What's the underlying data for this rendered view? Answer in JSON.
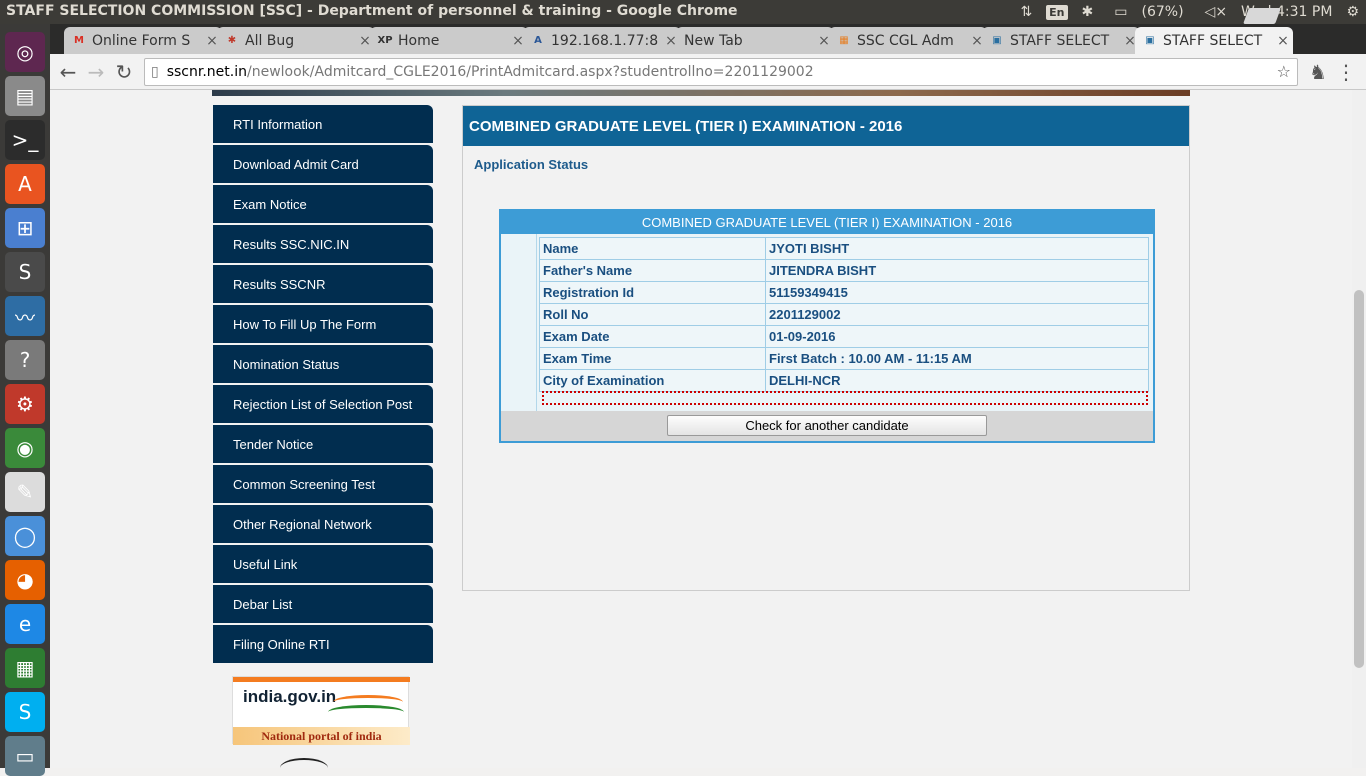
{
  "window_title": "STAFF SELECTION COMMISSION [SSC] - Department of personnel & training - Google Chrome",
  "tray": {
    "keyboard": "En",
    "battery": "(67%)",
    "clock": "Wed  4:31 PM"
  },
  "tabs": [
    {
      "label": "Online Form S",
      "favicon": "gmail-icon",
      "color": "#d93025",
      "glyph": "M"
    },
    {
      "label": "All Bug",
      "favicon": "bug-icon",
      "color": "#c0392b",
      "glyph": "✱"
    },
    {
      "label": "Home",
      "favicon": "xp-icon",
      "color": "#333333",
      "glyph": "XP"
    },
    {
      "label": "192.168.1.77:8",
      "favicon": "a-icon",
      "color": "#2b5797",
      "glyph": "A"
    },
    {
      "label": "New Tab",
      "favicon": "",
      "color": "",
      "glyph": ""
    },
    {
      "label": "SSC CGL Adm",
      "favicon": "grid-icon",
      "color": "#e67e22",
      "glyph": "▦"
    },
    {
      "label": "STAFF SELECT",
      "favicon": "ssc-icon",
      "color": "#2a6fa0",
      "glyph": "▣"
    },
    {
      "label": "STAFF SELECT",
      "favicon": "ssc-icon",
      "color": "#2a6fa0",
      "glyph": "▣",
      "active": true
    }
  ],
  "address": {
    "host": "sscnr.net.in",
    "path": "/newlook/Admitcard_CGLE2016/PrintAdmitcard.aspx?studentrollno=2201129002"
  },
  "menu": [
    "RTI Information",
    "Download Admit Card",
    "Exam Notice",
    "Results SSC.NIC.IN",
    "Results SSCNR",
    "How To Fill Up The Form",
    "Nomination Status",
    "Rejection List of Selection Post",
    "Tender Notice",
    "Common Screening Test",
    "Other Regional Network",
    "Useful Link",
    "Debar List",
    "Filing Online RTI"
  ],
  "india_portal": {
    "logo_text": "india.gov.in",
    "tagline": "National portal of india"
  },
  "panel": {
    "heading": "COMBINED GRADUATE LEVEL (TIER I) EXAMINATION - 2016",
    "status_label": "Application Status",
    "card_title": "COMBINED GRADUATE LEVEL (TIER I) EXAMINATION - 2016",
    "rows": [
      {
        "label": "Name",
        "value": "JYOTI BISHT"
      },
      {
        "label": "Father's Name",
        "value": "JITENDRA BISHT"
      },
      {
        "label": "Registration Id",
        "value": "51159349415"
      },
      {
        "label": "Roll No",
        "value": "2201129002"
      },
      {
        "label": "Exam Date",
        "value": "01-09-2016"
      },
      {
        "label": "Exam Time",
        "value": "First Batch : 10.00 AM - 11:15 AM"
      },
      {
        "label": "City of Examination",
        "value": "DELHI-NCR"
      }
    ],
    "button_label": "Check for another candidate"
  },
  "launcher_icons": [
    {
      "name": "ubuntu-dash-icon",
      "color": "#5e2750",
      "glyph": "◎"
    },
    {
      "name": "files-icon",
      "color": "#8a8a8a",
      "glyph": "▤"
    },
    {
      "name": "terminal-icon",
      "color": "#2c2c2c",
      "glyph": ">_"
    },
    {
      "name": "software-center-icon",
      "color": "#e95420",
      "glyph": "A"
    },
    {
      "name": "windows-icon",
      "color": "#4a7fd0",
      "glyph": "⊞"
    },
    {
      "name": "sublime-icon",
      "color": "#4a4a4a",
      "glyph": "S"
    },
    {
      "name": "wireshark-icon",
      "color": "#2e6da4",
      "glyph": "〰"
    },
    {
      "name": "help-icon",
      "color": "#7a7a7a",
      "glyph": "?"
    },
    {
      "name": "settings-icon",
      "color": "#c0392b",
      "glyph": "⚙"
    },
    {
      "name": "chrome-icon",
      "color": "#3a8a3a",
      "glyph": "◉"
    },
    {
      "name": "text-editor-icon",
      "color": "#dcdcdc",
      "glyph": "✎"
    },
    {
      "name": "chromium-icon",
      "color": "#4a90d9",
      "glyph": "◯"
    },
    {
      "name": "firefox-icon",
      "color": "#e66000",
      "glyph": "◕"
    },
    {
      "name": "ie-icon",
      "color": "#1e88e5",
      "glyph": "e"
    },
    {
      "name": "spreadsheet-icon",
      "color": "#2e7d32",
      "glyph": "▦"
    },
    {
      "name": "skype-icon",
      "color": "#00aff0",
      "glyph": "S"
    },
    {
      "name": "drive-icon",
      "color": "#607d8b",
      "glyph": "▭"
    }
  ]
}
